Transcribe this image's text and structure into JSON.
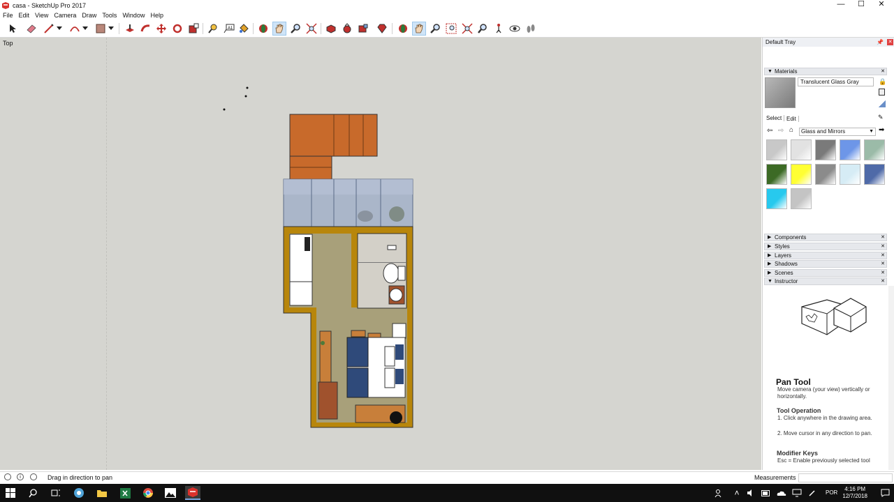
{
  "window": {
    "title": "casa - SketchUp Pro 2017",
    "minimize": "—",
    "maximize": "☐",
    "close": "✕"
  },
  "menu": [
    "File",
    "Edit",
    "View",
    "Camera",
    "Draw",
    "Tools",
    "Window",
    "Help"
  ],
  "viewport": {
    "view_label": "Top"
  },
  "tray": {
    "title": "Default Tray",
    "materials": {
      "header": "Materials",
      "current_material": "Translucent Glass Gray",
      "tab_select": "Select",
      "tab_edit": "Edit",
      "collection": "Glass and Mirrors",
      "swatches": [
        "#c8c8c8",
        "#e2e2e2",
        "#7a7a7a",
        "#6d96e8",
        "#9bbba8",
        "#3c6a25",
        "#ffff33",
        "#8b8b8b",
        "#d6ecf5",
        "#4f6aa8",
        "#27c9ee",
        "#c4c4c4"
      ]
    },
    "panels": [
      "Components",
      "Styles",
      "Layers",
      "Shadows",
      "Scenes",
      "Instructor"
    ],
    "instructor": {
      "tool_name": "Pan Tool",
      "description": "Move camera (your view) vertically or horizontally.",
      "operation_title": "Tool Operation",
      "steps": [
        "1. Click anywhere in the drawing area.",
        "2. Move cursor in any direction to pan."
      ],
      "modifier_title": "Modifier Keys",
      "modifier_text": "Esc = Enable previously selected tool"
    }
  },
  "status": {
    "hint": "Drag in direction to pan",
    "measurements_label": "Measurements"
  },
  "taskbar": {
    "lang": "POR",
    "time": "4:16 PM",
    "date": "12/7/2018"
  }
}
